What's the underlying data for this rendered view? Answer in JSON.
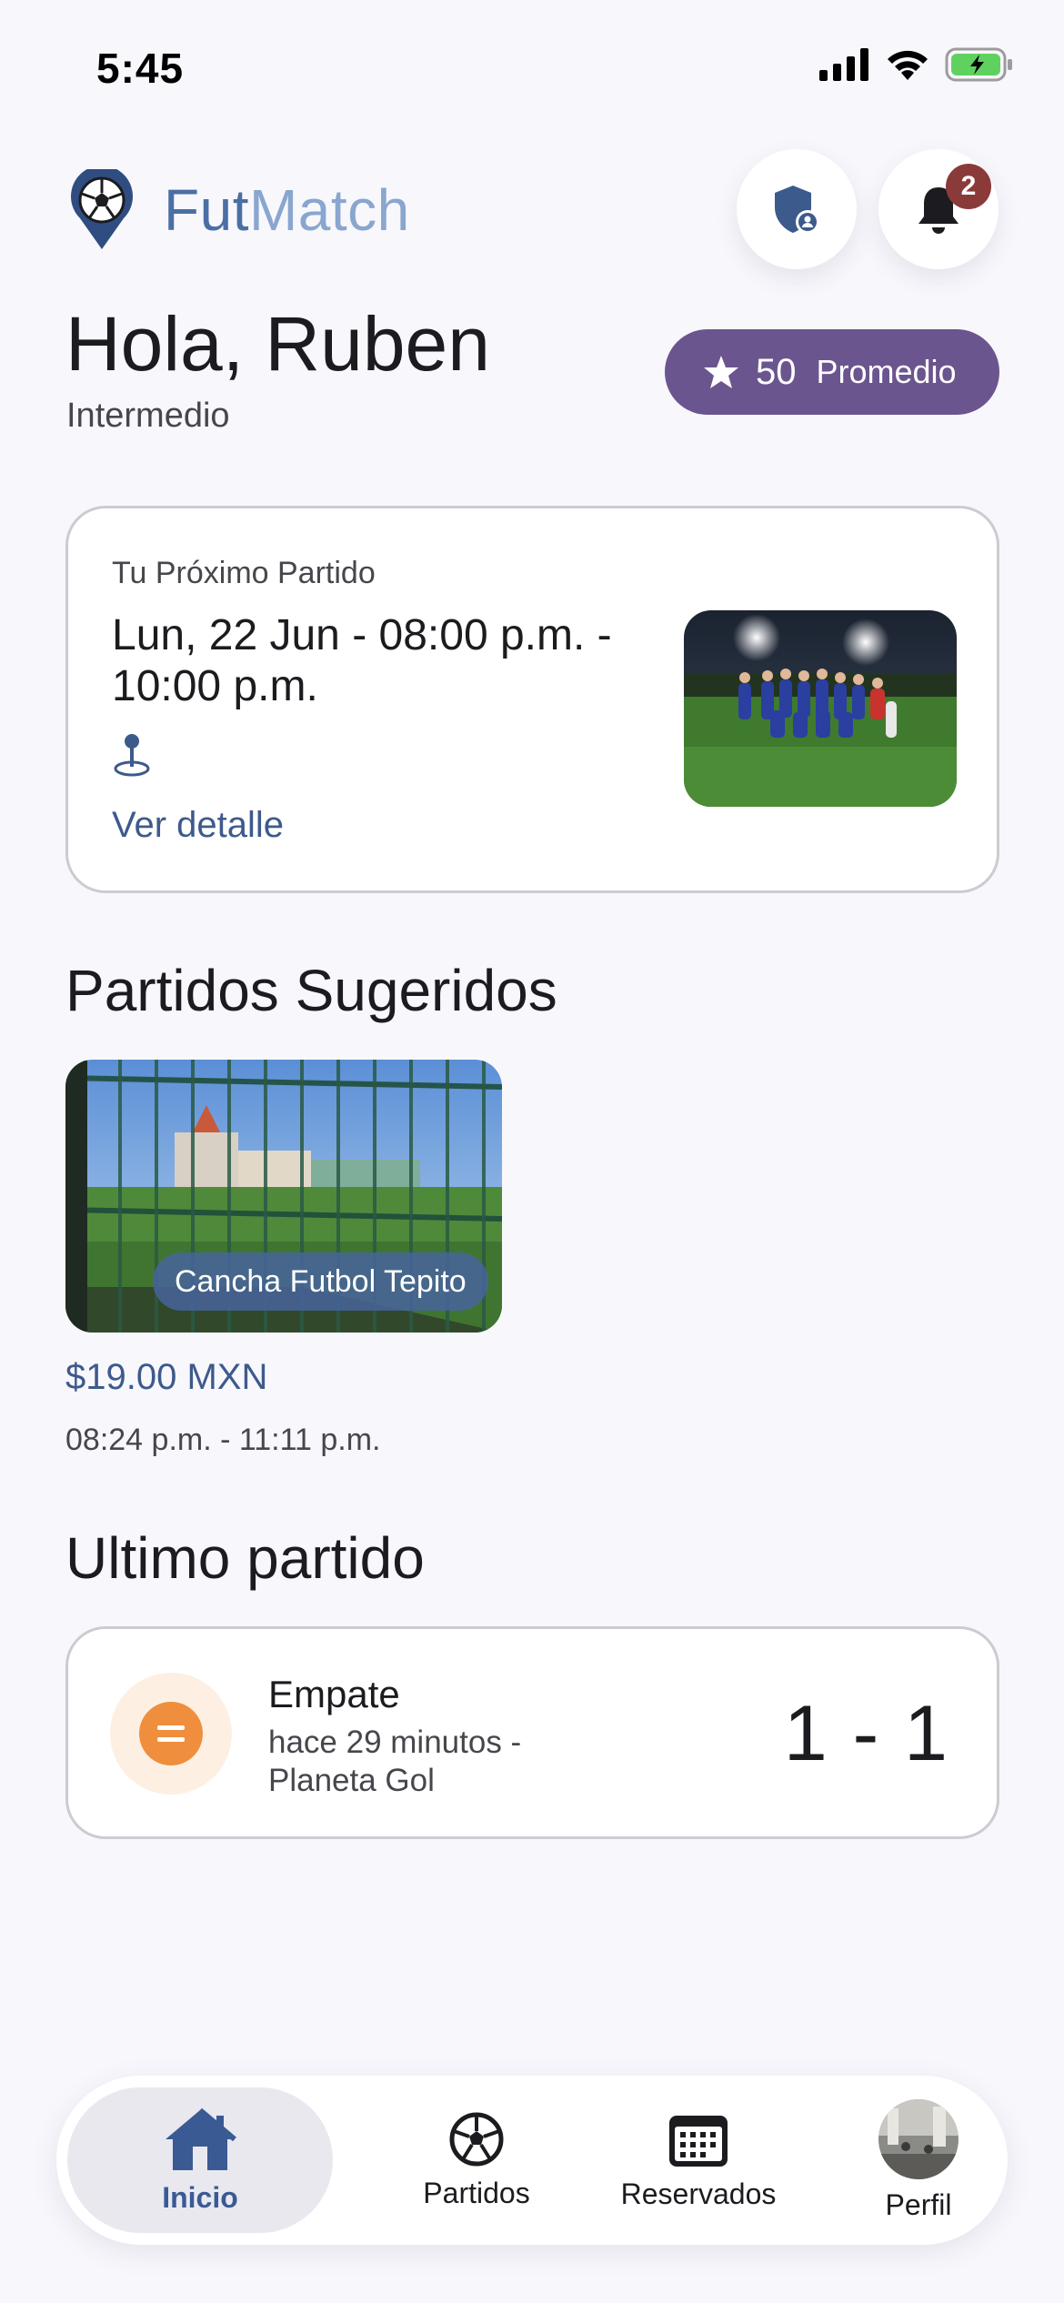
{
  "status_bar": {
    "time": "5:45"
  },
  "header": {
    "brand_part1": "Fut",
    "brand_part2": "Match",
    "notifications_count": "2"
  },
  "greeting": {
    "title": "Hola, Ruben",
    "level": "Intermedio"
  },
  "rating": {
    "value": "50",
    "label": "Promedio"
  },
  "next_match": {
    "label": "Tu Próximo Partido",
    "datetime": "Lun, 22 Jun - 08:00 p.m. - 10:00 p.m.",
    "detail_link": "Ver detalle"
  },
  "suggested": {
    "title": "Partidos Sugeridos",
    "items": [
      {
        "name": "Cancha Futbol Tepito",
        "price": "$19.00 MXN",
        "time": "08:24 p.m. - 11:11 p.m."
      }
    ]
  },
  "last_match": {
    "title": "Ultimo partido",
    "result": "Empate",
    "meta": "hace 29 minutos - Planeta Gol",
    "score": "1 - 1"
  },
  "nav": {
    "items": [
      {
        "label": "Inicio",
        "icon": "home-icon",
        "active": true
      },
      {
        "label": "Partidos",
        "icon": "soccer-ball-icon"
      },
      {
        "label": "Reservados",
        "icon": "calendar-icon"
      },
      {
        "label": "Perfil",
        "icon": "avatar"
      }
    ]
  },
  "colors": {
    "brand": "#4a6fa5",
    "rating_pill": "#6b558e",
    "draw_accent": "#ef8e3c",
    "badge": "#8b3a3a"
  }
}
